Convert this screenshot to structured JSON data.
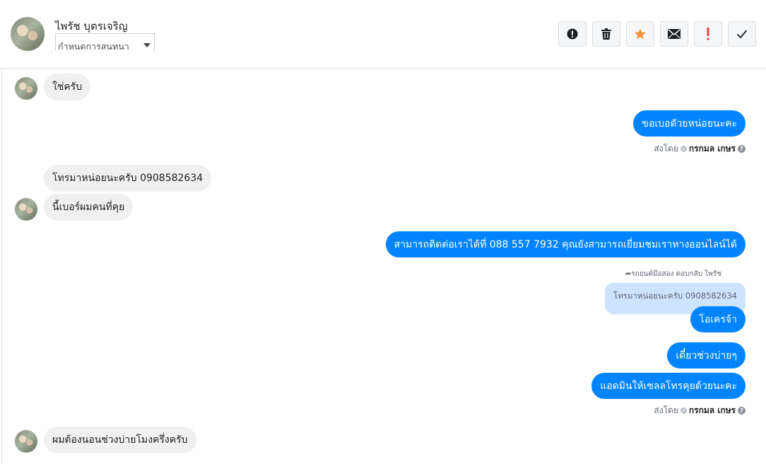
{
  "header": {
    "contact_name": "ไพรัช บุตรเจริญ",
    "conversation_select": "กำหนดการสนทนา",
    "toolbar": [
      {
        "name": "alert-icon",
        "label": "!"
      },
      {
        "name": "trash-icon",
        "label": ""
      },
      {
        "name": "star-icon",
        "label": ""
      },
      {
        "name": "mail-icon",
        "label": ""
      },
      {
        "name": "exclamation-icon",
        "label": "!"
      },
      {
        "name": "check-icon",
        "label": ""
      }
    ],
    "colors": {
      "star": "#f7923a",
      "exclamation": "#fa3e3e",
      "accent": "#0084ff"
    }
  },
  "messages": {
    "m1": "ใช่ครับ",
    "m2": "ขอเบอดัวยหน่อยนะคะ",
    "m3": "โทรมาหน่อยนะครับ 0908582634",
    "m4": "นี้เบอร์ผมคนที่คุย",
    "m5": "สามารถติดต่อเราได้ที่ 088 557 7932 คุณยังสามารถเยี่ยมชมเราทางออนไลน์ได้",
    "reply_note": "รถยนต์มือสอง ตอบกลับ ไพรัช",
    "quoted": "โทรมาหน่อยนะครับ 0908582634",
    "m6": "โอเครจ้า",
    "m7": "เดี๋ยวช่วงบ่ายๆ",
    "m8": "แอดมินให้เซลลโทรคุยด้วยนะคะ",
    "m9": "ผมต้องนอนช่วงบ่ายโมงครึ่งครับ"
  },
  "sent_by": {
    "prefix": "ส่งโดย",
    "who": "กรกมล เกษร",
    "help": "?"
  }
}
